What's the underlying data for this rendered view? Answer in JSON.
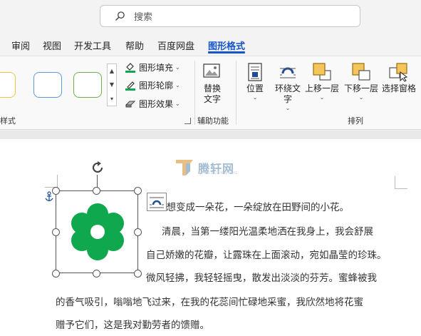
{
  "search": {
    "placeholder": "搜索"
  },
  "tabs": [
    {
      "label": "审阅",
      "active": false
    },
    {
      "label": "视图",
      "active": false
    },
    {
      "label": "开发工具",
      "active": false
    },
    {
      "label": "帮助",
      "active": false
    },
    {
      "label": "百度网盘",
      "active": false
    },
    {
      "label": "图形格式",
      "active": true
    }
  ],
  "ribbon": {
    "shape_styles_label": "样式",
    "fill_label": "图形填充",
    "outline_label": "图形轮廓",
    "effects_label": "图形效果",
    "alt_text_label": "替换文字",
    "accessibility_group": "辅助功能",
    "position_label": "位置",
    "wrap_text_label": "环绕文字",
    "bring_forward_label": "上移一层",
    "send_backward_label": "下移一层",
    "selection_pane_label": "选择窗格",
    "arrange_group": "排列"
  },
  "watermark": {
    "text": "腾轩网",
    "sub": "TENGXUANWANG"
  },
  "document": {
    "lines": [
      "我想变成一朵花，一朵绽放在田野间的小花。",
      "清晨，当第一缕阳光温柔地洒在我身上，我会舒展",
      "自己娇嫩的花瓣，让露珠在上面滚动，宛如晶莹的珍珠。",
      "微风轻拂，我轻轻摇曳，散发出淡淡的芬芳。蜜蜂被我",
      "的香气吸引，嗡嗡地飞过来，在我的花蕊间忙碌地采蜜，我欣然地将花蜜",
      "赠予它们，这是我对勤劳者的馈赠。"
    ]
  },
  "colors": {
    "accent": "#1555c7",
    "flower": "#10a84e",
    "watermark": "#9bb5cf"
  }
}
